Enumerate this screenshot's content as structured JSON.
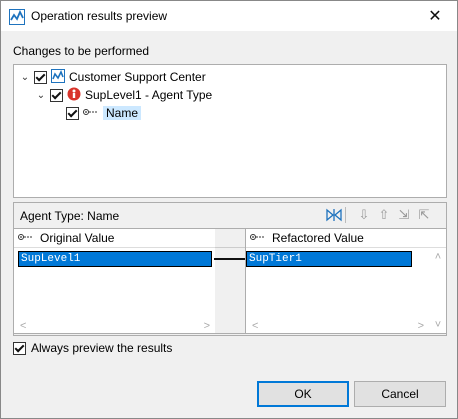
{
  "window": {
    "title": "Operation results preview"
  },
  "changes": {
    "label": "Changes to be performed",
    "tree": [
      {
        "label": "Customer Support Center",
        "icon": "anylogic-model-icon"
      },
      {
        "label": "SupLevel1 - Agent Type",
        "icon": "agent-type-icon"
      },
      {
        "label": "Name",
        "icon": "parameter-icon"
      }
    ]
  },
  "agent_panel": {
    "label": "Agent Type: Name"
  },
  "compare": {
    "original_header": "Original Value",
    "refactored_header": "Refactored Value",
    "original_value": "SupLevel1",
    "refactored_value": "SupTier1"
  },
  "options": {
    "always_preview_label": "Always preview the results"
  },
  "buttons": {
    "ok": "OK",
    "cancel": "Cancel"
  }
}
